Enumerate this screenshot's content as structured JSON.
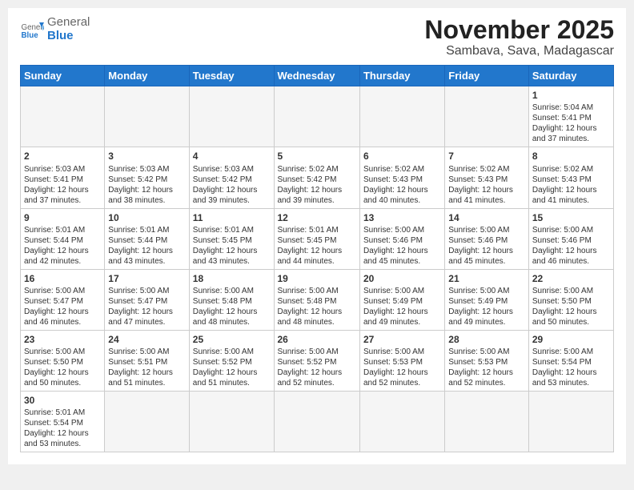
{
  "header": {
    "logo_general": "General",
    "logo_blue": "Blue",
    "month": "November 2025",
    "location": "Sambava, Sava, Madagascar"
  },
  "weekdays": [
    "Sunday",
    "Monday",
    "Tuesday",
    "Wednesday",
    "Thursday",
    "Friday",
    "Saturday"
  ],
  "weeks": [
    [
      {
        "day": "",
        "info": ""
      },
      {
        "day": "",
        "info": ""
      },
      {
        "day": "",
        "info": ""
      },
      {
        "day": "",
        "info": ""
      },
      {
        "day": "",
        "info": ""
      },
      {
        "day": "",
        "info": ""
      },
      {
        "day": "1",
        "info": "Sunrise: 5:04 AM\nSunset: 5:41 PM\nDaylight: 12 hours and 37 minutes."
      }
    ],
    [
      {
        "day": "2",
        "info": "Sunrise: 5:03 AM\nSunset: 5:41 PM\nDaylight: 12 hours and 37 minutes."
      },
      {
        "day": "3",
        "info": "Sunrise: 5:03 AM\nSunset: 5:42 PM\nDaylight: 12 hours and 38 minutes."
      },
      {
        "day": "4",
        "info": "Sunrise: 5:03 AM\nSunset: 5:42 PM\nDaylight: 12 hours and 39 minutes."
      },
      {
        "day": "5",
        "info": "Sunrise: 5:02 AM\nSunset: 5:42 PM\nDaylight: 12 hours and 39 minutes."
      },
      {
        "day": "6",
        "info": "Sunrise: 5:02 AM\nSunset: 5:43 PM\nDaylight: 12 hours and 40 minutes."
      },
      {
        "day": "7",
        "info": "Sunrise: 5:02 AM\nSunset: 5:43 PM\nDaylight: 12 hours and 41 minutes."
      },
      {
        "day": "8",
        "info": "Sunrise: 5:02 AM\nSunset: 5:43 PM\nDaylight: 12 hours and 41 minutes."
      }
    ],
    [
      {
        "day": "9",
        "info": "Sunrise: 5:01 AM\nSunset: 5:44 PM\nDaylight: 12 hours and 42 minutes."
      },
      {
        "day": "10",
        "info": "Sunrise: 5:01 AM\nSunset: 5:44 PM\nDaylight: 12 hours and 43 minutes."
      },
      {
        "day": "11",
        "info": "Sunrise: 5:01 AM\nSunset: 5:45 PM\nDaylight: 12 hours and 43 minutes."
      },
      {
        "day": "12",
        "info": "Sunrise: 5:01 AM\nSunset: 5:45 PM\nDaylight: 12 hours and 44 minutes."
      },
      {
        "day": "13",
        "info": "Sunrise: 5:00 AM\nSunset: 5:46 PM\nDaylight: 12 hours and 45 minutes."
      },
      {
        "day": "14",
        "info": "Sunrise: 5:00 AM\nSunset: 5:46 PM\nDaylight: 12 hours and 45 minutes."
      },
      {
        "day": "15",
        "info": "Sunrise: 5:00 AM\nSunset: 5:46 PM\nDaylight: 12 hours and 46 minutes."
      }
    ],
    [
      {
        "day": "16",
        "info": "Sunrise: 5:00 AM\nSunset: 5:47 PM\nDaylight: 12 hours and 46 minutes."
      },
      {
        "day": "17",
        "info": "Sunrise: 5:00 AM\nSunset: 5:47 PM\nDaylight: 12 hours and 47 minutes."
      },
      {
        "day": "18",
        "info": "Sunrise: 5:00 AM\nSunset: 5:48 PM\nDaylight: 12 hours and 48 minutes."
      },
      {
        "day": "19",
        "info": "Sunrise: 5:00 AM\nSunset: 5:48 PM\nDaylight: 12 hours and 48 minutes."
      },
      {
        "day": "20",
        "info": "Sunrise: 5:00 AM\nSunset: 5:49 PM\nDaylight: 12 hours and 49 minutes."
      },
      {
        "day": "21",
        "info": "Sunrise: 5:00 AM\nSunset: 5:49 PM\nDaylight: 12 hours and 49 minutes."
      },
      {
        "day": "22",
        "info": "Sunrise: 5:00 AM\nSunset: 5:50 PM\nDaylight: 12 hours and 50 minutes."
      }
    ],
    [
      {
        "day": "23",
        "info": "Sunrise: 5:00 AM\nSunset: 5:50 PM\nDaylight: 12 hours and 50 minutes."
      },
      {
        "day": "24",
        "info": "Sunrise: 5:00 AM\nSunset: 5:51 PM\nDaylight: 12 hours and 51 minutes."
      },
      {
        "day": "25",
        "info": "Sunrise: 5:00 AM\nSunset: 5:52 PM\nDaylight: 12 hours and 51 minutes."
      },
      {
        "day": "26",
        "info": "Sunrise: 5:00 AM\nSunset: 5:52 PM\nDaylight: 12 hours and 52 minutes."
      },
      {
        "day": "27",
        "info": "Sunrise: 5:00 AM\nSunset: 5:53 PM\nDaylight: 12 hours and 52 minutes."
      },
      {
        "day": "28",
        "info": "Sunrise: 5:00 AM\nSunset: 5:53 PM\nDaylight: 12 hours and 52 minutes."
      },
      {
        "day": "29",
        "info": "Sunrise: 5:00 AM\nSunset: 5:54 PM\nDaylight: 12 hours and 53 minutes."
      }
    ],
    [
      {
        "day": "30",
        "info": "Sunrise: 5:01 AM\nSunset: 5:54 PM\nDaylight: 12 hours and 53 minutes."
      },
      {
        "day": "",
        "info": ""
      },
      {
        "day": "",
        "info": ""
      },
      {
        "day": "",
        "info": ""
      },
      {
        "day": "",
        "info": ""
      },
      {
        "day": "",
        "info": ""
      },
      {
        "day": "",
        "info": ""
      }
    ]
  ]
}
